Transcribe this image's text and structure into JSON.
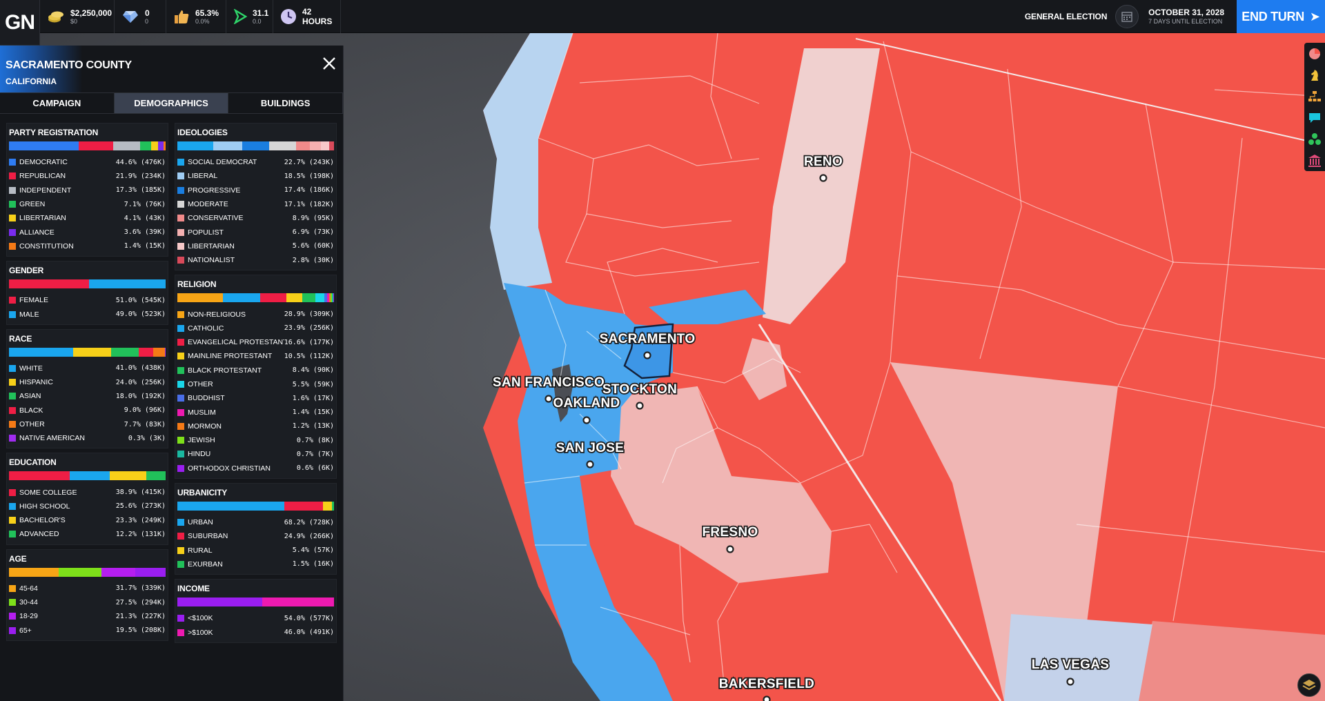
{
  "topbar": {
    "logo": "GN",
    "money": {
      "value": "$2,250,000",
      "sub": "$0",
      "icon": "coins-icon"
    },
    "gems": {
      "value": "0",
      "sub": "0",
      "icon": "gem-icon"
    },
    "approval": {
      "value": "65.3%",
      "sub": "0.0%",
      "icon": "thumbs-up-icon"
    },
    "momentum": {
      "value": "31.1",
      "sub": "0.0",
      "icon": "momentum-icon"
    },
    "hours": {
      "value": "42 HOURS",
      "icon": "clock-icon"
    },
    "election_label": "GENERAL ELECTION",
    "date": "OCTOBER 31, 2028",
    "until": "7 DAYS UNTIL ELECTION",
    "end_turn": "END TURN"
  },
  "panel": {
    "county": "SACRAMENTO COUNTY",
    "state": "CALIFORNIA",
    "tabs": [
      "CAMPAIGN",
      "DEMOGRAPHICS",
      "BUILDINGS"
    ],
    "active_tab": "DEMOGRAPHICS",
    "left_cards": [
      {
        "title": "PARTY REGISTRATION",
        "items": [
          {
            "name": "DEMOCRATIC",
            "pct": 44.6,
            "value": "44.6% (476K)",
            "color": "#2f7cf2"
          },
          {
            "name": "REPUBLICAN",
            "pct": 21.9,
            "value": "21.9% (234K)",
            "color": "#ef1e45"
          },
          {
            "name": "INDEPENDENT",
            "pct": 17.3,
            "value": "17.3% (185K)",
            "color": "#b7bcc4"
          },
          {
            "name": "GREEN",
            "pct": 7.1,
            "value": "7.1% (76K)",
            "color": "#21c15a"
          },
          {
            "name": "LIBERTARIAN",
            "pct": 4.1,
            "value": "4.1% (43K)",
            "color": "#f7d019"
          },
          {
            "name": "ALLIANCE",
            "pct": 3.6,
            "value": "3.6% (39K)",
            "color": "#7a2cf0"
          },
          {
            "name": "CONSTITUTION",
            "pct": 1.4,
            "value": "1.4% (15K)",
            "color": "#f57a16"
          }
        ]
      },
      {
        "title": "GENDER",
        "items": [
          {
            "name": "FEMALE",
            "pct": 51.0,
            "value": "51.0% (545K)",
            "color": "#ef1e45"
          },
          {
            "name": "MALE",
            "pct": 49.0,
            "value": "49.0% (523K)",
            "color": "#1aa6ee"
          }
        ]
      },
      {
        "title": "RACE",
        "items": [
          {
            "name": "WHITE",
            "pct": 41.0,
            "value": "41.0% (438K)",
            "color": "#1aa6ee"
          },
          {
            "name": "HISPANIC",
            "pct": 24.0,
            "value": "24.0% (256K)",
            "color": "#f7d019"
          },
          {
            "name": "ASIAN",
            "pct": 18.0,
            "value": "18.0% (192K)",
            "color": "#21c15a"
          },
          {
            "name": "BLACK",
            "pct": 9.0,
            "value": "9.0% (96K)",
            "color": "#ef1e45"
          },
          {
            "name": "OTHER",
            "pct": 7.7,
            "value": "7.7% (83K)",
            "color": "#f57a16"
          },
          {
            "name": "NATIVE AMERICAN",
            "pct": 0.3,
            "value": "0.3% (3K)",
            "color": "#a02cf0"
          }
        ]
      },
      {
        "title": "EDUCATION",
        "items": [
          {
            "name": "SOME COLLEGE",
            "pct": 38.9,
            "value": "38.9% (415K)",
            "color": "#ef1e45"
          },
          {
            "name": "HIGH SCHOOL",
            "pct": 25.6,
            "value": "25.6% (273K)",
            "color": "#1aa6ee"
          },
          {
            "name": "BACHELOR'S",
            "pct": 23.3,
            "value": "23.3% (249K)",
            "color": "#f7d019"
          },
          {
            "name": "ADVANCED",
            "pct": 12.2,
            "value": "12.2% (131K)",
            "color": "#21c15a"
          }
        ]
      },
      {
        "title": "AGE",
        "items": [
          {
            "name": "45-64",
            "pct": 31.7,
            "value": "31.7% (339K)",
            "color": "#f7a516"
          },
          {
            "name": "30-44",
            "pct": 27.5,
            "value": "27.5% (294K)",
            "color": "#7ee01a"
          },
          {
            "name": "18-29",
            "pct": 21.3,
            "value": "21.3% (227K)",
            "color": "#b51ef0"
          },
          {
            "name": "65+",
            "pct": 19.5,
            "value": "19.5% (208K)",
            "color": "#9a1ef0"
          }
        ]
      }
    ],
    "right_cards": [
      {
        "title": "IDEOLOGIES",
        "items": [
          {
            "name": "SOCIAL DEMOCRAT",
            "pct": 22.7,
            "value": "22.7% (243K)",
            "color": "#1aa6ee"
          },
          {
            "name": "LIBERAL",
            "pct": 18.5,
            "value": "18.5% (198K)",
            "color": "#9fcdf4"
          },
          {
            "name": "PROGRESSIVE",
            "pct": 17.4,
            "value": "17.4% (186K)",
            "color": "#1a7ee0"
          },
          {
            "name": "MODERATE",
            "pct": 17.1,
            "value": "17.1% (182K)",
            "color": "#d6d6d6"
          },
          {
            "name": "CONSERVATIVE",
            "pct": 8.9,
            "value": "8.9% (95K)",
            "color": "#f08a8a"
          },
          {
            "name": "POPULIST",
            "pct": 6.9,
            "value": "6.9% (73K)",
            "color": "#f4b0b0"
          },
          {
            "name": "LIBERTARIAN",
            "pct": 5.6,
            "value": "5.6% (60K)",
            "color": "#f7c9c9"
          },
          {
            "name": "NATIONALIST",
            "pct": 2.8,
            "value": "2.8% (30K)",
            "color": "#d94a5a"
          }
        ]
      },
      {
        "title": "RELIGION",
        "items": [
          {
            "name": "NON-RELIGIOUS",
            "pct": 28.9,
            "value": "28.9% (309K)",
            "color": "#f7a516"
          },
          {
            "name": "CATHOLIC",
            "pct": 23.9,
            "value": "23.9% (256K)",
            "color": "#1aa6ee"
          },
          {
            "name": "EVANGELICAL PROTESTANT",
            "pct": 16.6,
            "value": "16.6% (177K)",
            "color": "#ef1e45"
          },
          {
            "name": "MAINLINE PROTESTANT",
            "pct": 10.5,
            "value": "10.5% (112K)",
            "color": "#f7d019"
          },
          {
            "name": "BLACK PROTESTANT",
            "pct": 8.4,
            "value": "8.4% (90K)",
            "color": "#21c15a"
          },
          {
            "name": "OTHER",
            "pct": 5.5,
            "value": "5.5% (59K)",
            "color": "#1ad6e8"
          },
          {
            "name": "BUDDHIST",
            "pct": 1.6,
            "value": "1.6% (17K)",
            "color": "#4a6ee8"
          },
          {
            "name": "MUSLIM",
            "pct": 1.4,
            "value": "1.4% (15K)",
            "color": "#ee1ab0"
          },
          {
            "name": "MORMON",
            "pct": 1.2,
            "value": "1.2% (13K)",
            "color": "#f57a16"
          },
          {
            "name": "JEWISH",
            "pct": 0.7,
            "value": "0.7% (8K)",
            "color": "#7ee01a"
          },
          {
            "name": "HINDU",
            "pct": 0.7,
            "value": "0.7% (7K)",
            "color": "#1ab8a0"
          },
          {
            "name": "ORTHODOX CHRISTIAN",
            "pct": 0.6,
            "value": "0.6% (6K)",
            "color": "#9a1ef0"
          }
        ]
      },
      {
        "title": "URBANICITY",
        "items": [
          {
            "name": "URBAN",
            "pct": 68.2,
            "value": "68.2% (728K)",
            "color": "#1aa6ee"
          },
          {
            "name": "SUBURBAN",
            "pct": 24.9,
            "value": "24.9% (266K)",
            "color": "#ef1e45"
          },
          {
            "name": "RURAL",
            "pct": 5.4,
            "value": "5.4% (57K)",
            "color": "#f7d019"
          },
          {
            "name": "EXURBAN",
            "pct": 1.5,
            "value": "1.5% (16K)",
            "color": "#21c15a"
          }
        ]
      },
      {
        "title": "INCOME",
        "items": [
          {
            "name": "<$100K",
            "pct": 54.0,
            "value": "54.0% (577K)",
            "color": "#9a1ef0"
          },
          {
            "name": ">$100K",
            "pct": 46.0,
            "value": "46.0% (491K)",
            "color": "#ee1ab0"
          }
        ]
      }
    ]
  },
  "map": {
    "cities": [
      {
        "name": "RENO"
      },
      {
        "name": "SACRAMENTO"
      },
      {
        "name": "SAN FRANCISCO"
      },
      {
        "name": "STOCKTON"
      },
      {
        "name": "OAKLAND"
      },
      {
        "name": "SAN JOSE"
      },
      {
        "name": "FRESNO"
      },
      {
        "name": "LAS VEGAS"
      },
      {
        "name": "BAKERSFIELD"
      }
    ],
    "colors": {
      "strong_dem": "#4aa6ee",
      "lean_dem": "#b8d4f0",
      "strong_rep": "#f3544a",
      "lean_rep": "#f0b6b4",
      "ocean": "#4b4e55"
    }
  },
  "rail_icons": [
    "pie-chart-icon",
    "chess-knight-icon",
    "org-chart-icon",
    "chat-icon",
    "hexagons-icon",
    "capitol-icon"
  ],
  "corner_icon": "layers-icon"
}
